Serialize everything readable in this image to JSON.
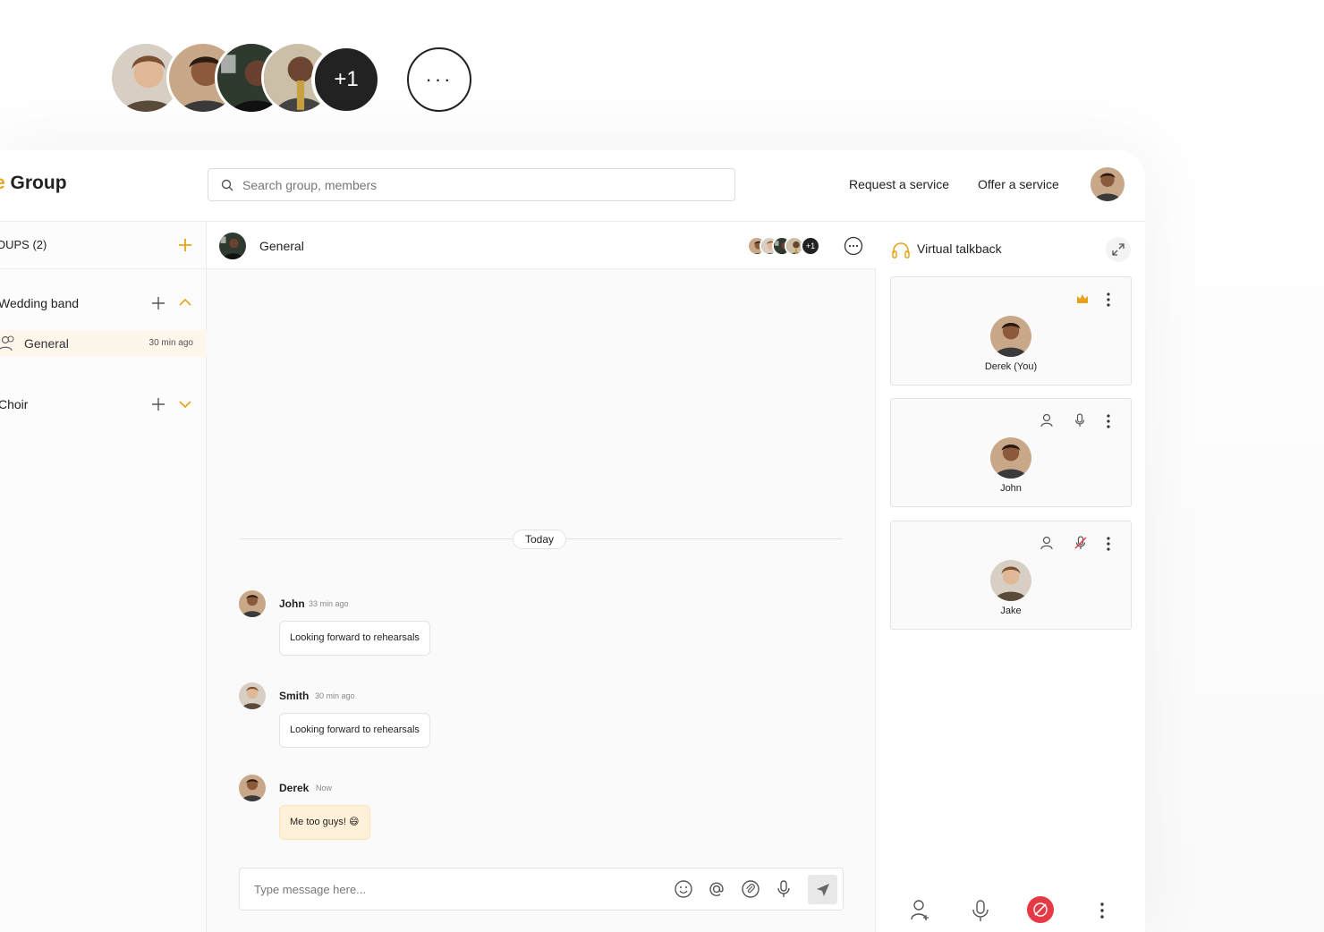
{
  "floating_stack": {
    "overflow_label": "+1",
    "more_label": "···"
  },
  "topbar": {
    "brand_prefix": "e",
    "brand": "Group",
    "search_placeholder": "Search group, members",
    "request_service": "Request a service",
    "offer_service": "Offer a service"
  },
  "sidebar": {
    "groups_title": "OUPS (2)",
    "groups": [
      {
        "name": "Wedding band",
        "expanded": true,
        "channels": [
          {
            "label": "General",
            "time": "30 min ago"
          }
        ]
      },
      {
        "name": "Choir",
        "expanded": false
      }
    ]
  },
  "chat": {
    "title": "General",
    "member_overflow": "+1",
    "day_divider": "Today",
    "messages": [
      {
        "author": "John",
        "time": "33 min ago",
        "text": "Looking forward to rehearsals"
      },
      {
        "author": "Smith",
        "time": "30 min ago",
        "text": "Looking forward to rehearsals"
      },
      {
        "author": "Derek",
        "time": "Now",
        "text": "Me too guys! 😄"
      }
    ],
    "composer_placeholder": "Type message here..."
  },
  "talkback": {
    "title": "Virtual talkback",
    "participants": [
      {
        "name": "Derek (You)",
        "host": true
      },
      {
        "name": "John",
        "muted": false
      },
      {
        "name": "Jake",
        "muted": true
      }
    ]
  },
  "colors": {
    "accent": "#e8a21a",
    "end_call": "#e53945",
    "own_bubble": "#fff1d9"
  }
}
